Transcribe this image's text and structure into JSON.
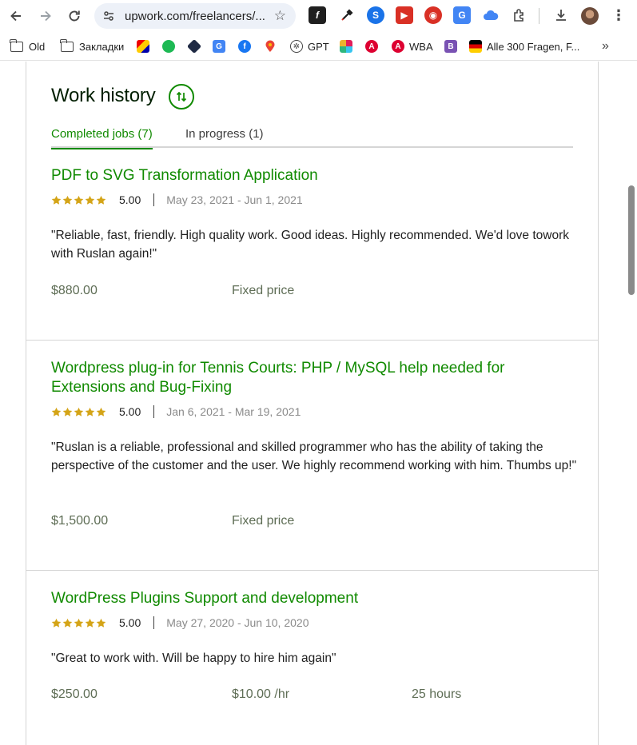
{
  "browser": {
    "url": "upwork.com/freelancers/...",
    "bookmarks": [
      {
        "label": "Old",
        "type": "folder"
      },
      {
        "label": "Закладки",
        "type": "folder"
      },
      {
        "label": "GPT",
        "type": "site"
      },
      {
        "label": "WBA",
        "type": "site"
      },
      {
        "label": "Alle 300 Fragen, F...",
        "type": "site"
      }
    ],
    "overflow": "»"
  },
  "work_history": {
    "title": "Work history",
    "tabs": [
      {
        "label": "Completed jobs (7)",
        "active": true
      },
      {
        "label": "In progress (1)",
        "active": false
      }
    ],
    "jobs": [
      {
        "title": "PDF to SVG Transformation Application",
        "rating": "5.00",
        "stars": 5,
        "dates": "May 23, 2021 - Jun 1, 2021",
        "feedback": "\"Reliable, fast, friendly. High quality work. Good ideas. Highly recommended. We'd love towork with Ruslan again!\"",
        "amount": "$880.00",
        "pricing": "Fixed price",
        "hours": ""
      },
      {
        "title": "Wordpress plug-in for Tennis Courts: PHP / MySQL help needed for Extensions and Bug-Fixing",
        "rating": "5.00",
        "stars": 5,
        "dates": "Jan 6, 2021 - Mar 19, 2021",
        "feedback": "\"Ruslan is a reliable, professional and skilled programmer who has the ability of taking the perspective of the customer and the user. We highly recommend working with him. Thumbs up!\"",
        "amount": "$1,500.00",
        "pricing": "Fixed price",
        "hours": ""
      },
      {
        "title": "WordPress Plugins Support and development",
        "rating": "5.00",
        "stars": 5,
        "dates": "May 27, 2020 - Jun 10, 2020",
        "feedback": "\"Great to work with. Will be happy to hire him again\"",
        "amount": "$250.00",
        "pricing": "$10.00 /hr",
        "hours": "25 hours"
      }
    ]
  },
  "colors": {
    "accent_green": "#108a00",
    "star_gold": "#d4a417",
    "muted_text": "#8a8a8a",
    "divider": "#d5d5d5"
  }
}
